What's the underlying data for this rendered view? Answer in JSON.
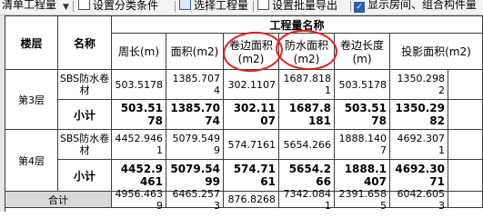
{
  "toolbar": {
    "items": [
      {
        "label": "清单工程量"
      },
      {
        "label": "设置分类条件"
      },
      {
        "label": "选择工程量"
      },
      {
        "label": "设置批量导出"
      },
      {
        "label": "显示房间、组合构件量"
      }
    ]
  },
  "table": {
    "group_header": "工程量名称",
    "headers": {
      "floor": "楼层",
      "name": "名称",
      "perimeter": "周长(m)",
      "area": "面积(m2)",
      "edge_area": "卷边面积(m2)",
      "waterproof_area": "防水面积(m2)",
      "edge_length": "卷边长度(m)",
      "projection_area": "投影面积(m2)"
    },
    "rows": [
      {
        "floor": "第3层",
        "material": "SBS防水卷材",
        "values": [
          "503.5178",
          "1385.7074",
          "302.1107",
          "1687.8181",
          "503.5178",
          "1350.2982"
        ],
        "subtotal_label": "小计",
        "subtotal": [
          "503.5178",
          "1385.7074",
          "302.1107",
          "1687.8181",
          "503.5178",
          "1350.2982"
        ]
      },
      {
        "floor": "第4层",
        "material": "SBS防水卷材",
        "values": [
          "4452.9461",
          "5079.5499",
          "574.7161",
          "5654.266",
          "1888.1407",
          "4692.3071"
        ],
        "subtotal_label": "小计",
        "subtotal": [
          "4452.9461",
          "5079.5499",
          "574.7161",
          "5654.266",
          "1888.1407",
          "4692.3071"
        ]
      }
    ],
    "total_label": "合计",
    "total": [
      "4956.4639",
      "6465.2573",
      "876.8268",
      "7342.0841",
      "2391.6585",
      "6042.6053"
    ]
  },
  "colors": {
    "annotation": "#e02020",
    "grid_line": "#3c3c3c",
    "total_bg": "#d9d9d9"
  }
}
